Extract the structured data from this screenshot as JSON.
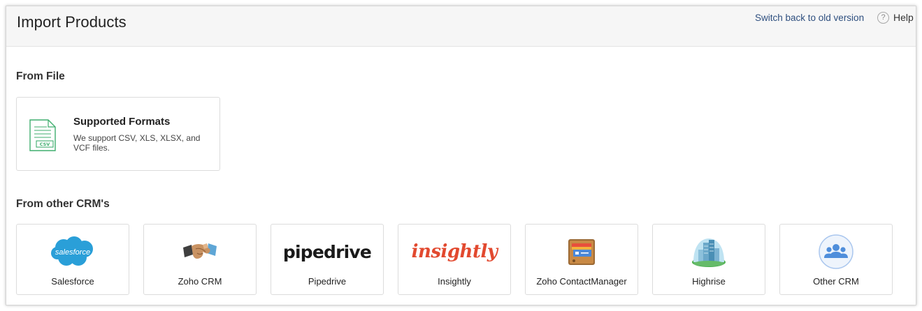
{
  "header": {
    "title": "Import Products",
    "switch_link": "Switch back to old version",
    "help_label": "Help",
    "help_icon_glyph": "?"
  },
  "from_file": {
    "section_title": "From File",
    "card": {
      "title": "Supported Formats",
      "description": "We support CSV, XLS, XLSX, and VCF files.",
      "icon": "csv-file-icon",
      "icon_text": "CSV"
    }
  },
  "from_crm": {
    "section_title": "From other CRM's",
    "items": [
      {
        "label": "Salesforce",
        "logo": "salesforce-logo",
        "logo_text": "salesforce"
      },
      {
        "label": "Zoho CRM",
        "logo": "handshake-logo"
      },
      {
        "label": "Pipedrive",
        "logo": "pipedrive-logo",
        "logo_text": "pipedrive"
      },
      {
        "label": "Insightly",
        "logo": "insightly-logo",
        "logo_text": "insightly"
      },
      {
        "label": "Zoho ContactManager",
        "logo": "contact-card-logo"
      },
      {
        "label": "Highrise",
        "logo": "highrise-building-logo"
      },
      {
        "label": "Other CRM",
        "logo": "people-group-logo"
      }
    ]
  },
  "colors": {
    "link": "#2e4f7f",
    "header_bg": "#f6f6f6",
    "csv_green": "#3fae6e",
    "salesforce_blue": "#2a9fd8",
    "insightly_red": "#e2492f",
    "other_crm_blue": "#4f8edb"
  }
}
